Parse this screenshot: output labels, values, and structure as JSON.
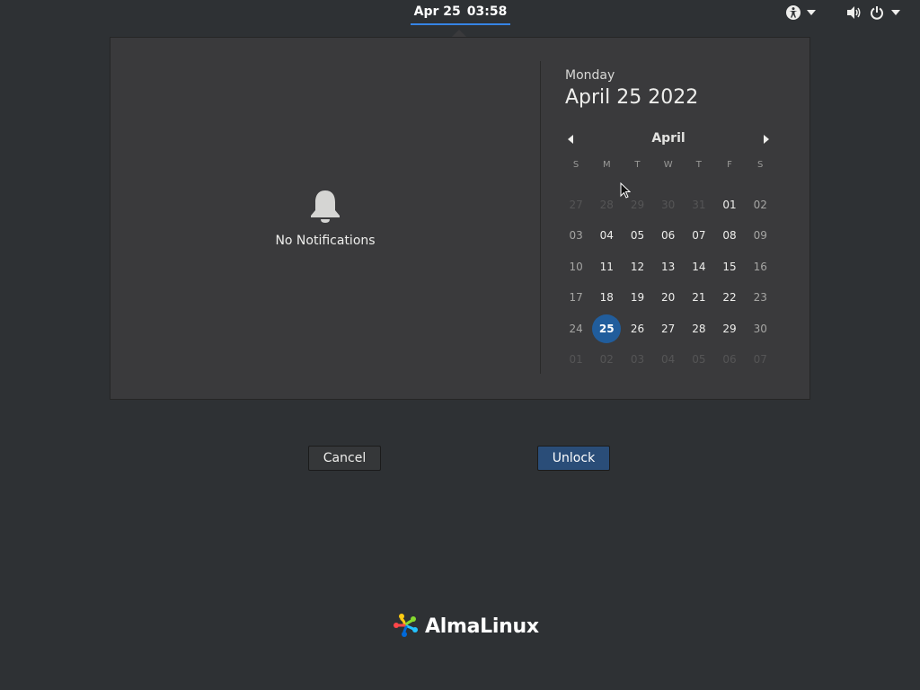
{
  "topbar": {
    "clock_date": "Apr 25",
    "clock_time": "03:58",
    "icons": [
      "accessibility-icon",
      "chevron-down-icon",
      "volume-icon",
      "power-icon",
      "chevron-down-icon"
    ]
  },
  "notifications": {
    "empty_label": "No Notifications",
    "icon": "bell-icon"
  },
  "calendar": {
    "weekday": "Monday",
    "date": "April 25 2022",
    "month": "April",
    "day_headers": [
      "S",
      "M",
      "T",
      "W",
      "T",
      "F",
      "S"
    ],
    "weeks": [
      [
        "27",
        "28",
        "29",
        "30",
        "31",
        "01",
        "02"
      ],
      [
        "03",
        "04",
        "05",
        "06",
        "07",
        "08",
        "09"
      ],
      [
        "10",
        "11",
        "12",
        "13",
        "14",
        "15",
        "16"
      ],
      [
        "17",
        "18",
        "19",
        "20",
        "21",
        "22",
        "23"
      ],
      [
        "24",
        "25",
        "26",
        "27",
        "28",
        "29",
        "30"
      ],
      [
        "01",
        "02",
        "03",
        "04",
        "05",
        "06",
        "07"
      ]
    ],
    "today": "25",
    "accent_color": "#215d9c"
  },
  "buttons": {
    "cancel_label": "Cancel",
    "unlock_label": "Unlock"
  },
  "branding": {
    "logo_text": "AlmaLinux"
  }
}
